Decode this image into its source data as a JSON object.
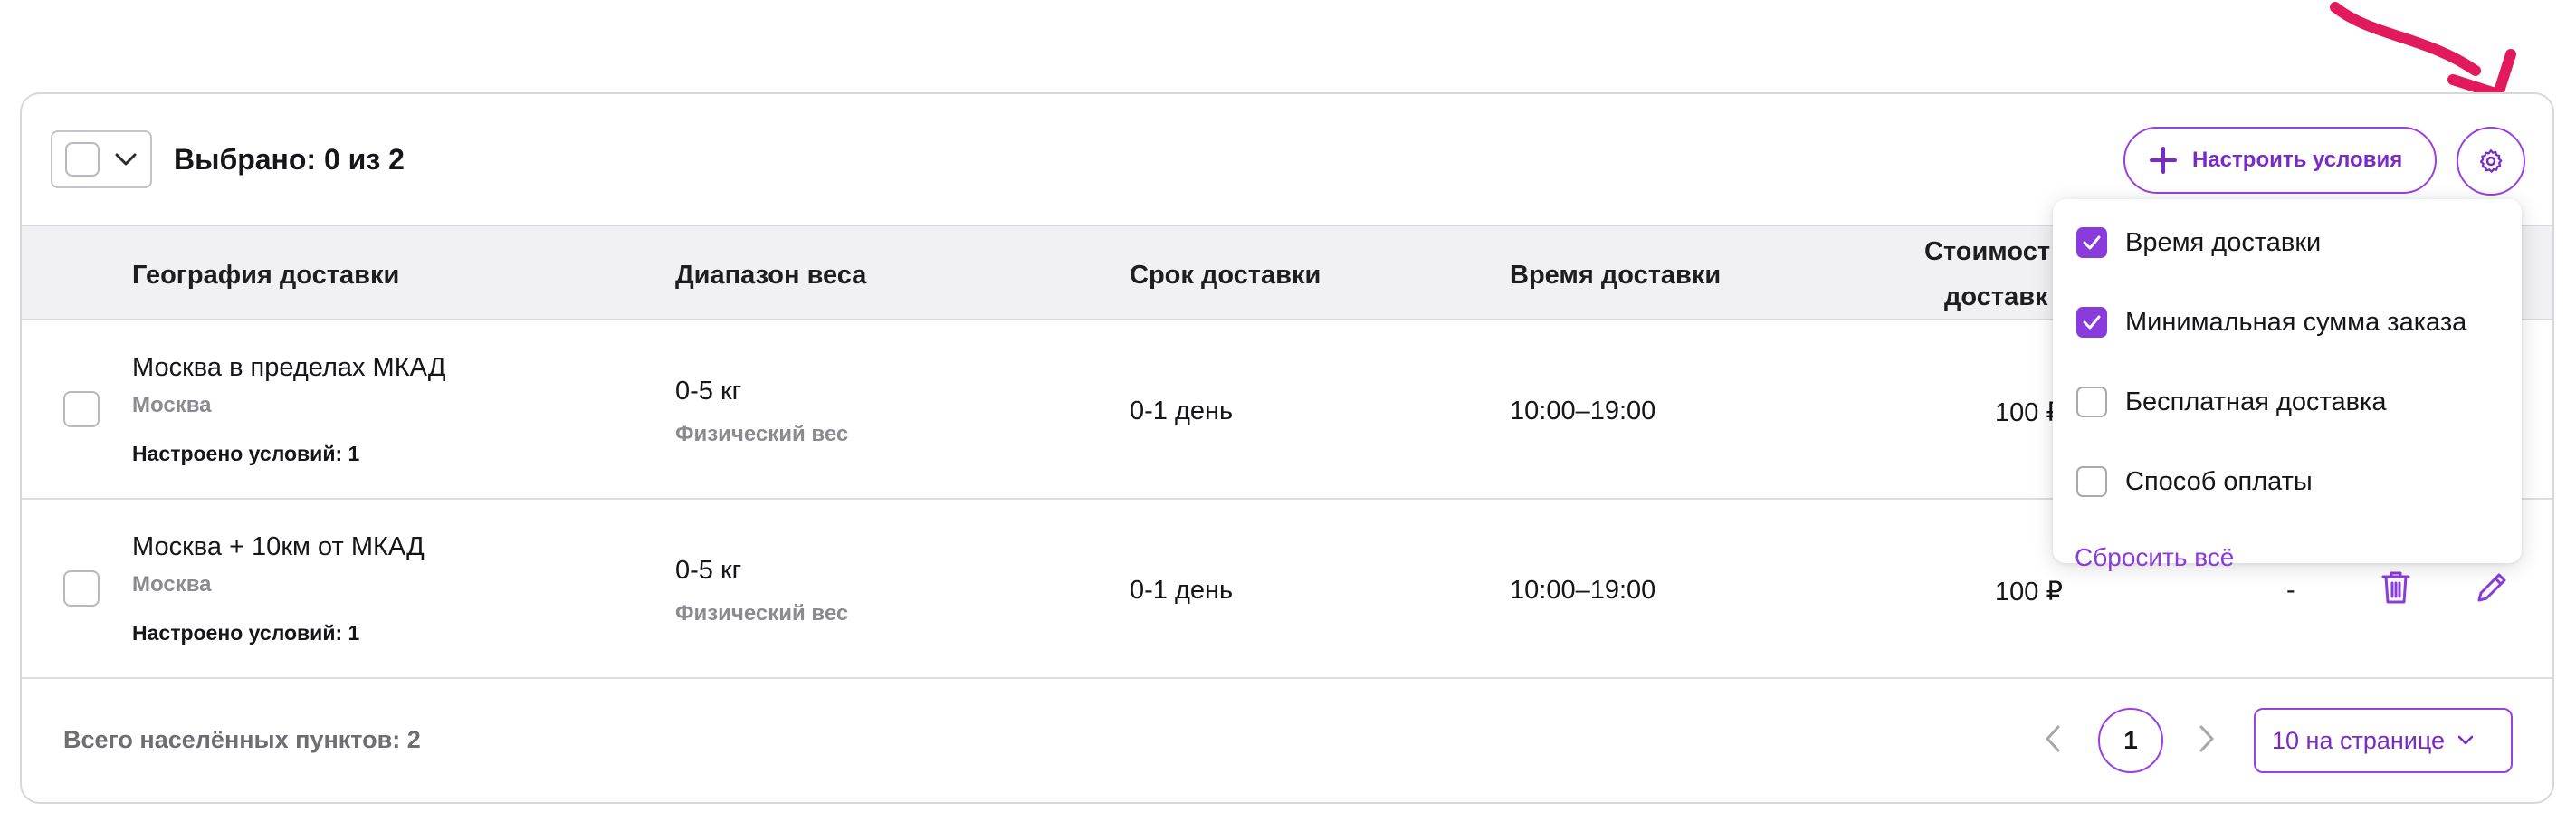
{
  "colors": {
    "accent": "#9a3fe0",
    "accent_text": "#7a2bc6",
    "arrow": "#e2195b",
    "header_bg": "#f1f1f3"
  },
  "toolbar": {
    "selected_label": "Выбрано: 0 из 2",
    "configure_button": "Настроить условия",
    "settings_icon": "gear-icon"
  },
  "table": {
    "headers": {
      "geography": "География доставки",
      "weight": "Диапазон веса",
      "term": "Срок доставки",
      "time": "Время доставки",
      "cost_line1": "Стоимост",
      "cost_line2": "доставк"
    },
    "rows": [
      {
        "geo": "Москва в пределах МКАД",
        "city": "Москва",
        "conditions": "Настроено условий: 1",
        "weight": "0-5 кг",
        "weight_type": "Физический вес",
        "term": "0-1 день",
        "time": "10:00–19:00",
        "cost": "100 ₽"
      },
      {
        "geo": "Москва + 10км от МКАД",
        "city": "Москва",
        "conditions": "Настроено условий: 1",
        "weight": "0-5 кг",
        "weight_type": "Физический вес",
        "term": "0-1 день",
        "time": "10:00–19:00",
        "cost": "100 ₽",
        "extra": "-"
      }
    ]
  },
  "footer": {
    "total": "Всего населённых пунктов: 2",
    "current_page": "1",
    "per_page": "10 на странице"
  },
  "columns_menu": {
    "items": [
      {
        "label": "Время доставки",
        "checked": true
      },
      {
        "label": "Минимальная сумма заказа",
        "checked": true
      },
      {
        "label": "Бесплатная доставка",
        "checked": false
      },
      {
        "label": "Способ оплаты",
        "checked": false
      }
    ],
    "reset": "Сбросить всё"
  }
}
